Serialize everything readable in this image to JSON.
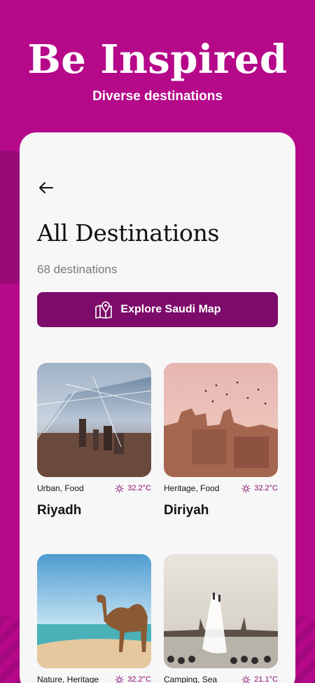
{
  "hero": {
    "title": "Be Inspired",
    "subtitle": "Diverse destinations"
  },
  "page": {
    "title": "All Destinations",
    "count": "68 destinations"
  },
  "map_button": {
    "label": "Explore Saudi Map"
  },
  "destinations": [
    {
      "name": "Riyadh",
      "tags": "Urban, Food",
      "temp": "32.2°C"
    },
    {
      "name": "Diriyah",
      "tags": "Heritage, Food",
      "temp": "32.2°C"
    },
    {
      "name": "",
      "tags": "Nature, Heritage",
      "temp": "32.2°C"
    },
    {
      "name": "",
      "tags": "Camping, Sea",
      "temp": "21.1°C"
    }
  ],
  "colors": {
    "brand": "#b5098a",
    "button": "#7c0b6a",
    "accent": "#8b0c6c"
  }
}
